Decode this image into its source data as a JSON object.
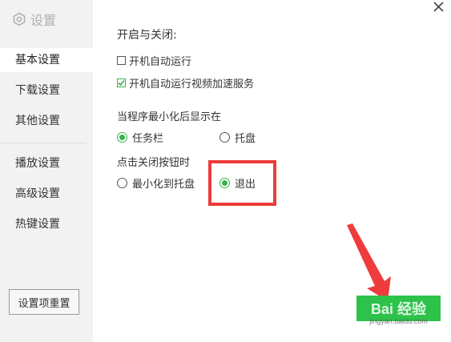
{
  "sidebar": {
    "title": "设置",
    "items": [
      {
        "label": "基本设置",
        "active": true
      },
      {
        "label": "下载设置",
        "active": false
      },
      {
        "label": "其他设置",
        "active": false
      },
      {
        "label": "播放设置",
        "active": false
      },
      {
        "label": "高级设置",
        "active": false
      },
      {
        "label": "热键设置",
        "active": false
      }
    ],
    "reset_label": "设置项重置"
  },
  "content": {
    "startup_section": "开启与关闭:",
    "autorun_label": "开机自动运行",
    "autorun_checked": false,
    "autorun_accel_label": "开机自动运行视频加速服务",
    "autorun_accel_checked": true,
    "minimize_section": "当程序最小化后显示在",
    "minimize_options": [
      {
        "label": "任务栏",
        "checked": true
      },
      {
        "label": "托盘",
        "checked": false
      }
    ],
    "close_section": "点击关闭按钮时",
    "close_options": [
      {
        "label": "最小化到托盘",
        "checked": false
      },
      {
        "label": "退出",
        "checked": true
      }
    ]
  },
  "watermark": {
    "text": "Bai 经验",
    "sub": "jingyan.baidu.com"
  },
  "colors": {
    "accent": "#36b34a",
    "highlight": "#ee3b3b",
    "button": "#2dc24a"
  }
}
